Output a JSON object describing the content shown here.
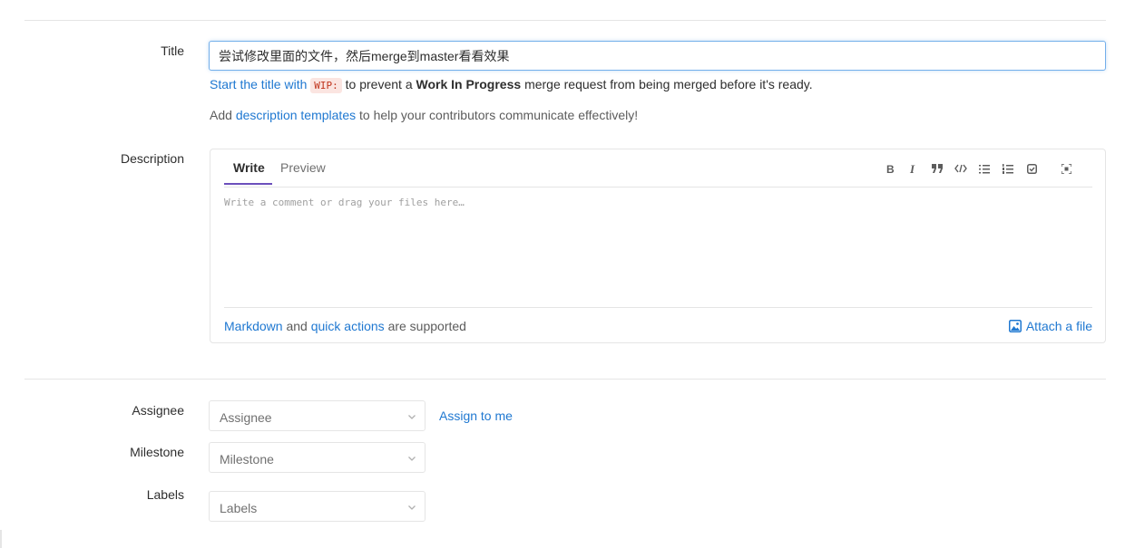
{
  "form": {
    "title": {
      "label": "Title",
      "value": "尝试修改里面的文件，然后merge到master看看效果"
    },
    "wip_hint": {
      "link": "Start the title with",
      "code": "WIP:",
      "text1": "to prevent a",
      "bold": "Work In Progress",
      "text2": "merge request from being merged before it's ready."
    },
    "templates_hint": {
      "prefix": "Add",
      "link": "description templates",
      "suffix": "to help your contributors communicate effectively!"
    },
    "description": {
      "label": "Description",
      "tabs": [
        {
          "label": "Write",
          "active": true
        },
        {
          "label": "Preview",
          "active": false
        }
      ],
      "toolbar": [
        "bold-icon",
        "italic-icon",
        "quote-icon",
        "code-icon",
        "bullet-list-icon",
        "numbered-list-icon",
        "task-list-icon",
        "fullscreen-icon"
      ],
      "placeholder": "Write a comment or drag your files here…",
      "footer": {
        "markdown_link": "Markdown",
        "and": "and",
        "quick_actions_link": "quick actions",
        "supported": "are supported",
        "attach": "Attach a file"
      }
    },
    "assignee": {
      "label": "Assignee",
      "placeholder": "Assignee",
      "assign_me": "Assign to me"
    },
    "milestone": {
      "label": "Milestone",
      "placeholder": "Milestone"
    },
    "labels": {
      "label": "Labels",
      "placeholder": "Labels"
    }
  },
  "colors": {
    "link": "#1f78d1",
    "tab_active_underline": "#6b4fbb",
    "input_focus_border": "#73afea",
    "code_text": "#c0341d",
    "code_bg": "#fbe5e1"
  }
}
